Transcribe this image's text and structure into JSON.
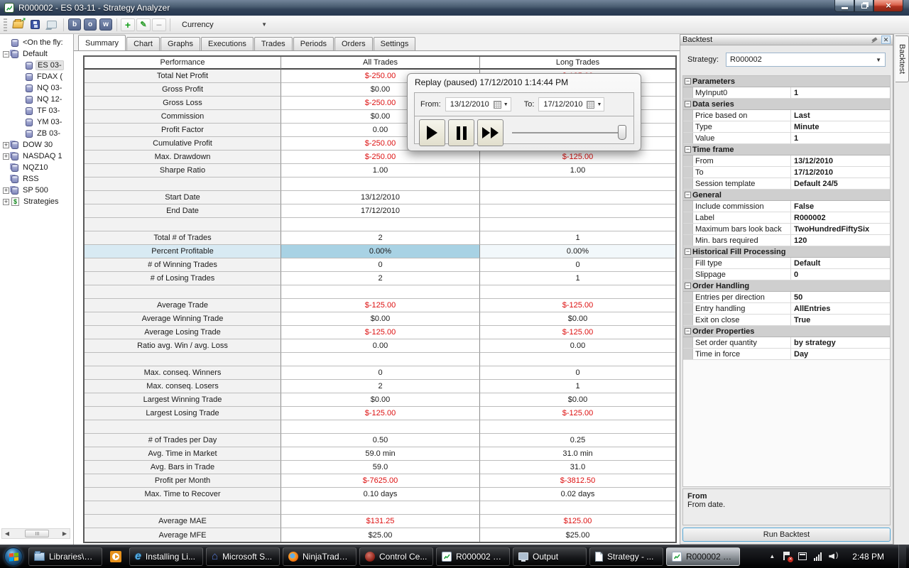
{
  "window": {
    "title": "R000002 - ES 03-11 - Strategy Analyzer"
  },
  "toolbar": {
    "items": [
      {
        "kind": "icon",
        "name": "open-folder-icon"
      },
      {
        "kind": "icon",
        "name": "save-icon"
      },
      {
        "kind": "icon",
        "name": "screenshot-icon"
      },
      {
        "kind": "sep"
      },
      {
        "kind": "letter",
        "name": "backtest-button",
        "label": "b"
      },
      {
        "kind": "letter",
        "name": "optimize-button",
        "label": "o"
      },
      {
        "kind": "letter",
        "name": "walk-forward-button",
        "label": "w"
      },
      {
        "kind": "sep"
      },
      {
        "kind": "icon",
        "name": "add-icon",
        "glyph": "+",
        "cls": "add"
      },
      {
        "kind": "icon",
        "name": "edit-icon",
        "glyph": "✎",
        "cls": "edit"
      },
      {
        "kind": "icon",
        "name": "remove-icon",
        "glyph": "−",
        "cls": "remove"
      },
      {
        "kind": "sep"
      },
      {
        "kind": "combo",
        "name": "display-unit-combo",
        "label": "Currency"
      }
    ]
  },
  "sidebar": {
    "items": [
      {
        "label": "<On the fly:",
        "level": 0,
        "box": "",
        "icon": "db"
      },
      {
        "label": "Default",
        "level": 0,
        "box": "-",
        "icon": "db3"
      },
      {
        "label": "ES 03-",
        "level": 1,
        "box": "",
        "icon": "db",
        "selected": true
      },
      {
        "label": "FDAX (",
        "level": 1,
        "box": "",
        "icon": "db"
      },
      {
        "label": "NQ 03-",
        "level": 1,
        "box": "",
        "icon": "db"
      },
      {
        "label": "NQ 12-",
        "level": 1,
        "box": "",
        "icon": "db"
      },
      {
        "label": "TF 03-",
        "level": 1,
        "box": "",
        "icon": "db"
      },
      {
        "label": "YM 03-",
        "level": 1,
        "box": "",
        "icon": "db"
      },
      {
        "label": "ZB 03-",
        "level": 1,
        "box": "",
        "icon": "db"
      },
      {
        "label": "DOW 30",
        "level": 0,
        "box": "+",
        "icon": "db3"
      },
      {
        "label": "NASDAQ 1",
        "level": 0,
        "box": "+",
        "icon": "db3"
      },
      {
        "label": "NQZ10",
        "level": 0,
        "box": "",
        "icon": "db3"
      },
      {
        "label": "RSS",
        "level": 0,
        "box": "",
        "icon": "db3"
      },
      {
        "label": "SP 500",
        "level": 0,
        "box": "+",
        "icon": "db3"
      },
      {
        "label": "Strategies",
        "level": 0,
        "box": "+",
        "icon": "dollar"
      }
    ]
  },
  "tabs": {
    "active": "Summary",
    "items": [
      "Summary",
      "Chart",
      "Graphs",
      "Executions",
      "Trades",
      "Periods",
      "Orders",
      "Settings"
    ]
  },
  "table": {
    "columns": [
      "Performance",
      "All Trades",
      "Long Trades"
    ],
    "rows": [
      {
        "label": "Total Net Profit",
        "all": "$-250.00",
        "long": "$-125.00",
        "ra": true,
        "rl": true
      },
      {
        "label": "Gross Profit",
        "all": "$0.00",
        "long": ""
      },
      {
        "label": "Gross Loss",
        "all": "$-250.00",
        "long": "",
        "ra": true
      },
      {
        "label": "Commission",
        "all": "$0.00",
        "long": ""
      },
      {
        "label": "Profit Factor",
        "all": "0.00",
        "long": ""
      },
      {
        "label": "Cumulative Profit",
        "all": "$-250.00",
        "long": "",
        "ra": true
      },
      {
        "label": "Max. Drawdown",
        "all": "$-250.00",
        "long": "$-125.00",
        "ra": true,
        "rl": true
      },
      {
        "label": "Sharpe Ratio",
        "all": "1.00",
        "long": "1.00"
      },
      {
        "spacer": true
      },
      {
        "label": "Start Date",
        "all": "13/12/2010",
        "long": ""
      },
      {
        "label": "End Date",
        "all": "17/12/2010",
        "long": ""
      },
      {
        "spacer": true
      },
      {
        "label": "Total # of Trades",
        "all": "2",
        "long": "1"
      },
      {
        "label": "Percent Profitable",
        "all": "0.00%",
        "long": "0.00%",
        "selected": true
      },
      {
        "label": "# of Winning Trades",
        "all": "0",
        "long": "0"
      },
      {
        "label": "# of Losing Trades",
        "all": "2",
        "long": "1"
      },
      {
        "spacer": true
      },
      {
        "label": "Average Trade",
        "all": "$-125.00",
        "long": "$-125.00",
        "ra": true,
        "rl": true
      },
      {
        "label": "Average Winning Trade",
        "all": "$0.00",
        "long": "$0.00"
      },
      {
        "label": "Average Losing Trade",
        "all": "$-125.00",
        "long": "$-125.00",
        "ra": true,
        "rl": true
      },
      {
        "label": "Ratio avg. Win / avg. Loss",
        "all": "0.00",
        "long": "0.00"
      },
      {
        "spacer": true
      },
      {
        "label": "Max. conseq. Winners",
        "all": "0",
        "long": "0"
      },
      {
        "label": "Max. conseq. Losers",
        "all": "2",
        "long": "1"
      },
      {
        "label": "Largest Winning Trade",
        "all": "$0.00",
        "long": "$0.00"
      },
      {
        "label": "Largest Losing Trade",
        "all": "$-125.00",
        "long": "$-125.00",
        "ra": true,
        "rl": true
      },
      {
        "spacer": true
      },
      {
        "label": "# of Trades per Day",
        "all": "0.50",
        "long": "0.25"
      },
      {
        "label": "Avg. Time in Market",
        "all": "59.0 min",
        "long": "31.0 min"
      },
      {
        "label": "Avg. Bars in Trade",
        "all": "59.0",
        "long": "31.0"
      },
      {
        "label": "Profit per Month",
        "all": "$-7625.00",
        "long": "$-3812.50",
        "ra": true,
        "rl": true
      },
      {
        "label": "Max. Time to Recover",
        "all": "0.10 days",
        "long": "0.02 days"
      },
      {
        "spacer": true
      },
      {
        "label": "Average MAE",
        "all": "$131.25",
        "long": "$125.00",
        "ra": true,
        "rl": true
      },
      {
        "label": "Average MFE",
        "all": "$25.00",
        "long": "$25.00"
      }
    ]
  },
  "replay": {
    "title": "Replay (paused) 17/12/2010 1:14:44 PM",
    "from_label": "From:",
    "from_value": "13/12/2010",
    "to_label": "To:",
    "to_value": "17/12/2010"
  },
  "backtest": {
    "title": "Backtest",
    "side_tab": "Backtest",
    "strategy_label": "Strategy:",
    "strategy_value": "R000002",
    "groups": [
      {
        "name": "Parameters",
        "items": [
          {
            "k": "MyInput0",
            "v": "1"
          }
        ]
      },
      {
        "name": "Data series",
        "items": [
          {
            "k": "Price based on",
            "v": "Last"
          },
          {
            "k": "Type",
            "v": "Minute"
          },
          {
            "k": "Value",
            "v": "1"
          }
        ]
      },
      {
        "name": "Time frame",
        "items": [
          {
            "k": "From",
            "v": "13/12/2010"
          },
          {
            "k": "To",
            "v": "17/12/2010"
          },
          {
            "k": "Session template",
            "v": "Default 24/5"
          }
        ]
      },
      {
        "name": "General",
        "items": [
          {
            "k": "Include commission",
            "v": "False"
          },
          {
            "k": "Label",
            "v": "R000002"
          },
          {
            "k": "Maximum bars look back",
            "v": "TwoHundredFiftySix"
          },
          {
            "k": "Min. bars required",
            "v": "120"
          }
        ]
      },
      {
        "name": "Historical Fill Processing",
        "items": [
          {
            "k": "Fill type",
            "v": "Default"
          },
          {
            "k": "Slippage",
            "v": "0"
          }
        ]
      },
      {
        "name": "Order Handling",
        "items": [
          {
            "k": "Entries per direction",
            "v": "50"
          },
          {
            "k": "Entry handling",
            "v": "AllEntries"
          },
          {
            "k": "Exit on close",
            "v": "True"
          }
        ]
      },
      {
        "name": "Order Properties",
        "items": [
          {
            "k": "Set order quantity",
            "v": "by strategy"
          },
          {
            "k": "Time in force",
            "v": "Day"
          }
        ]
      }
    ],
    "desc_title": "From",
    "desc_text": "From date.",
    "run_label": "Run Backtest"
  },
  "taskbar": {
    "items": [
      {
        "label": "Libraries\\Vi...",
        "icon": "folder"
      },
      {
        "label": "",
        "icon": "play",
        "iconOnly": true
      },
      {
        "label": "Installing Li...",
        "icon": "ie"
      },
      {
        "label": "Microsoft S...",
        "icon": "house"
      },
      {
        "label": "NinjaTrade...",
        "icon": "firefox"
      },
      {
        "label": "Control Ce...",
        "icon": "control"
      },
      {
        "label": "R000002 - E...",
        "icon": "ninja"
      },
      {
        "label": "Output",
        "icon": "monitor"
      },
      {
        "label": "Strategy - ...",
        "icon": "doc"
      },
      {
        "label": "R000002 - E...",
        "icon": "ninja",
        "active": true
      }
    ],
    "clock": "2:48 PM"
  },
  "colors": {
    "negative": "#dd1010",
    "selection_blue": "#a8d2e4",
    "taskbar_active": "#cdd6de"
  }
}
